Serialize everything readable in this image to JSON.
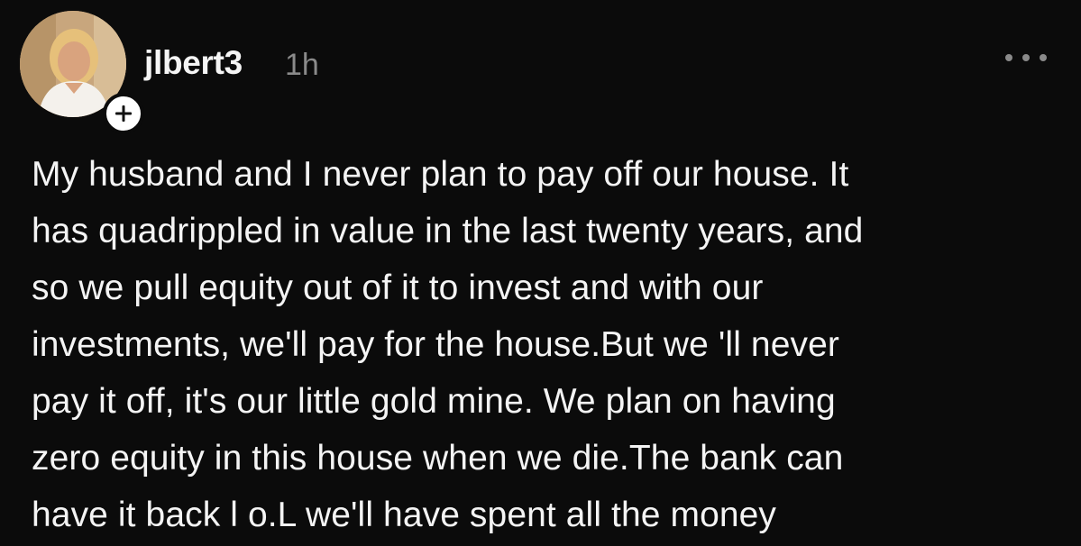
{
  "post": {
    "username": "jlbert3",
    "timestamp": "1h",
    "follow_icon": "plus-icon",
    "more_icon": "more-horizontal-icon",
    "text_lines": [
      "My husband and I never plan to pay off our house. It",
      "has quadrippled in value in the last twenty years, and",
      "so we pull equity out of it to invest and with our",
      "investments, we'll pay for the house.But we 'll never",
      "pay it off, it's our little gold mine. We plan on having",
      "zero equity in this house when we die.The bank can",
      "have it back l o.L we'll have spent all the money"
    ]
  },
  "colors": {
    "background": "#0b0b0b",
    "text": "#f4f4f4",
    "muted": "#8a8a8a"
  }
}
